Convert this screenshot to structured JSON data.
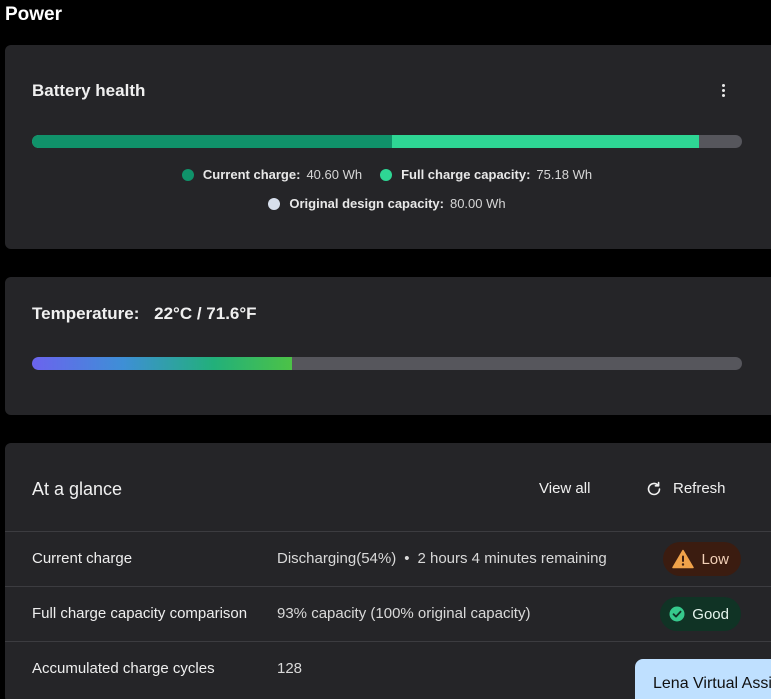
{
  "page": {
    "title": "Power"
  },
  "battery_health": {
    "title": "Battery health",
    "more_icon": "more-vertical-icon",
    "current_charge_wh": 40.6,
    "full_charge_capacity_wh": 75.18,
    "design_capacity_wh": 80.0,
    "legend": [
      {
        "label": "Current charge:",
        "value": "40.60 Wh",
        "color": "#10926a"
      },
      {
        "label": "Full charge capacity:",
        "value": "75.18 Wh",
        "color": "#2ed694"
      },
      {
        "label": "Original design capacity:",
        "value": "80.00 Wh",
        "color": "#d7dfec"
      }
    ]
  },
  "temperature": {
    "label": "Temperature:",
    "value": "22°C / 71.6°F",
    "level_percent": 36.6
  },
  "glance": {
    "title": "At a glance",
    "view_all": "View all",
    "refresh": "Refresh",
    "refresh_icon": "refresh-icon",
    "rows": [
      {
        "label": "Current charge",
        "value": "Discharging(54%)",
        "extra": "2 hours 4 minutes remaining",
        "badge": "Low",
        "badge_icon": "warning-icon"
      },
      {
        "label": "Full charge capacity comparison",
        "value": "93% capacity (100% original capacity)",
        "badge": "Good",
        "badge_icon": "check-circle-icon"
      },
      {
        "label": "Accumulated charge cycles",
        "value": "128"
      }
    ]
  },
  "assistant": {
    "label": "Lena Virtual Assistant"
  }
}
